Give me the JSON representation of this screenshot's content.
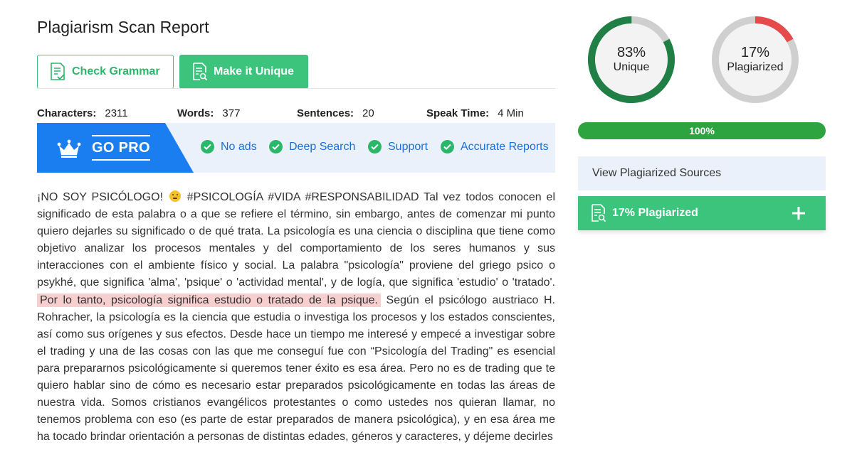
{
  "title": "Plagiarism Scan Report",
  "buttons": {
    "check_grammar": "Check Grammar",
    "make_unique": "Make it Unique"
  },
  "stats": [
    {
      "label": "Characters:",
      "value": "2311"
    },
    {
      "label": "Words:",
      "value": "377"
    },
    {
      "label": "Sentences:",
      "value": "20"
    },
    {
      "label": "Speak Time:",
      "value": "4 Min"
    }
  ],
  "pro": {
    "label": "GO PRO",
    "features": [
      "No ads",
      "Deep Search",
      "Support",
      "Accurate Reports"
    ]
  },
  "content": {
    "part1": "¡NO SOY PSICÓLOGO! ",
    "part1b": " #PSICOLOGÍA #VIDA #RESPONSABILIDAD Tal vez todos conocen el significado de esta palabra o a que se refiere el término, sin embargo, antes de comenzar mi punto quiero dejarles su significado o de qué trata. La psicología es una ciencia o disciplina que tiene como objetivo analizar los procesos mentales y del comportamiento de los seres humanos y sus interacciones con el ambiente físico y social. La palabra \"psicología\" proviene del griego psico o psykhé, que significa 'alma', 'psique' o 'actividad mental', y de logía, que significa 'estudio' o 'tratado'.",
    "highlight": "Por lo tanto, psicología significa estudio o tratado de la psique.",
    "part2": " Según el psicólogo austriaco H. Rohracher, la psicología es la ciencia que estudia o investiga los procesos y los estados conscientes, así como sus orígenes y sus efectos. Desde hace un tiempo me interesé y empecé a investigar sobre el trading y una de las cosas con las que me conseguí fue con “Psicología del Trading\" es esencial para prepararnos psicológicamente si queremos tener éxito es esa área. Pero no es de trading que te quiero hablar sino de cómo es necesario estar preparados psicológicamente en todas las áreas de nuestra vida. Somos cristianos evangélicos protestantes o como ustedes nos quieran llamar, no tenemos problema con eso (es parte de estar preparados de manera psicológica), y en esa área me ha tocado brindar orientación a personas de distintas edades, géneros y caracteres, y déjeme decirles"
  },
  "results": {
    "unique": {
      "percent": "83%",
      "label": "Unique",
      "value": 83,
      "color": "#1f7f45"
    },
    "plagiarized": {
      "percent": "17%",
      "label": "Plagiarized",
      "value": 17,
      "color": "#e54b4b"
    },
    "track_color": "#cfcfcf",
    "progress_label": "100%",
    "progress_value": 100,
    "sources_label": "View Plagiarized Sources",
    "plag_box_label": "17% Plagiarized"
  },
  "colors": {
    "green": "#3cc47c",
    "blue": "#1a7df0",
    "light_blue_bg": "#eaf1fa",
    "highlight": "#f8cfcf"
  }
}
